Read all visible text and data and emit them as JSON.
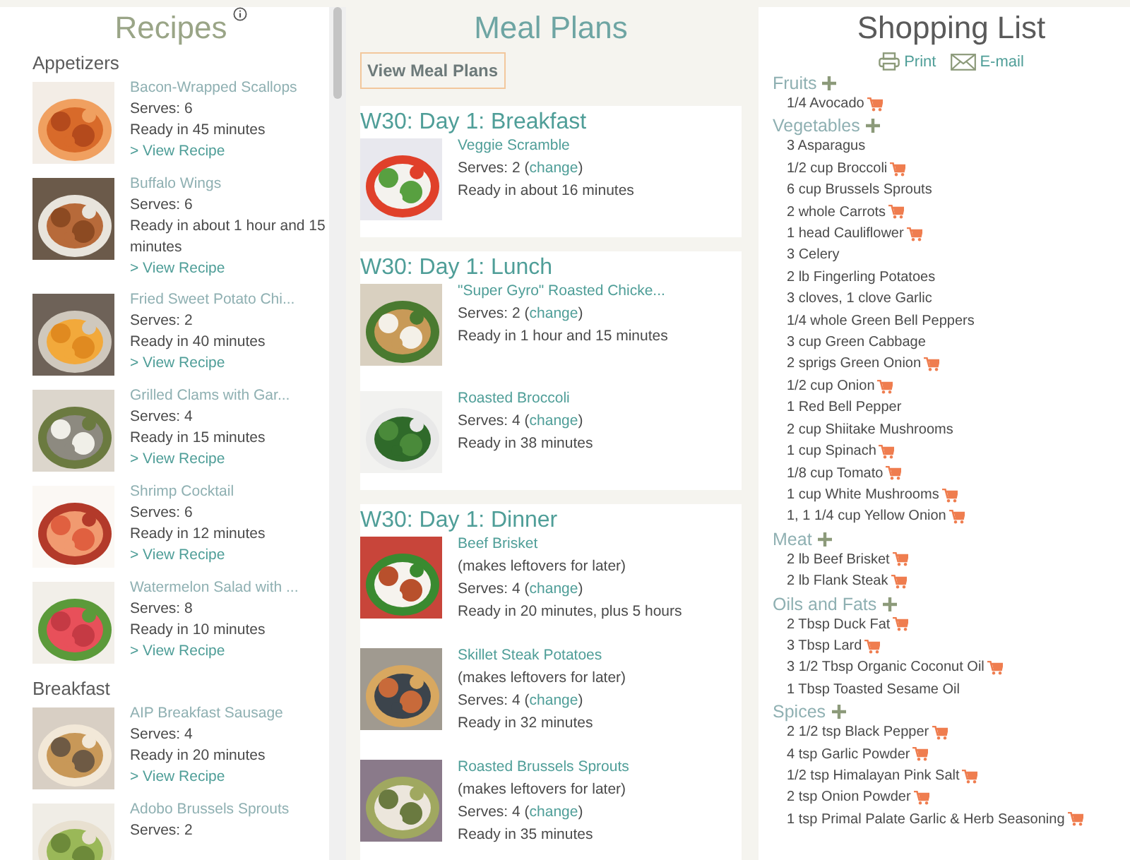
{
  "recipes": {
    "title": "Recipes",
    "sections": [
      {
        "name": "Appetizers",
        "items": [
          {
            "title": "Bacon-Wrapped Scallops",
            "serves": "Serves: 6",
            "ready": "Ready in 45 minutes",
            "link": "> View Recipe",
            "kind": "picture"
          },
          {
            "title": "Buffalo Wings",
            "serves": "Serves: 6",
            "ready": "Ready in about 1 hour and 15 minutes",
            "link": "> View Recipe",
            "kind": "picture"
          },
          {
            "title": "Fried Sweet Potato Chi...",
            "serves": "Serves: 2",
            "ready": "Ready in 40 minutes",
            "link": "> View Recipe",
            "kind": "picture"
          },
          {
            "title": "Grilled Clams with Gar...",
            "serves": "Serves: 4",
            "ready": "Ready in 15 minutes",
            "link": "> View Recipe",
            "kind": "picture"
          },
          {
            "title": "Shrimp Cocktail",
            "serves": "Serves: 6",
            "ready": "Ready in 12 minutes",
            "link": "> View Recipe",
            "kind": "picture"
          },
          {
            "title": "Watermelon Salad with ...",
            "serves": "Serves: 8",
            "ready": "Ready in 10 minutes",
            "link": "> View Recipe",
            "kind": "picture"
          }
        ]
      },
      {
        "name": "Breakfast",
        "items": [
          {
            "title": "AIP Breakfast Sausage",
            "serves": "Serves: 4",
            "ready": "Ready in 20 minutes",
            "link": "> View Recipe",
            "kind": "picture"
          },
          {
            "title": "Adobo Brussels Sprouts",
            "serves": "Serves: 2",
            "kind": "picture"
          }
        ]
      }
    ]
  },
  "meal_plans": {
    "title": "Meal Plans",
    "button": "View Meal Plans",
    "meals": [
      {
        "title": "W30: Day 1: Breakfast",
        "recipes": [
          {
            "name": "Veggie Scramble",
            "serves": "Serves: 2 (",
            "change": "change",
            "close": ")",
            "ready": "Ready in about 16 minutes",
            "kind": "picture"
          }
        ]
      },
      {
        "title": "W30: Day 1: Lunch",
        "recipes": [
          {
            "name": "\"Super Gyro\" Roasted Chicke...",
            "serves": "Serves: 2 (",
            "change": "change",
            "close": ")",
            "ready": "Ready in 1 hour and 15 minutes",
            "kind": "picture"
          },
          {
            "name": "Roasted Broccoli",
            "serves": "Serves: 4 (",
            "change": "change",
            "close": ")",
            "ready": "Ready in 38 minutes",
            "kind": "picture"
          }
        ]
      },
      {
        "title": "W30: Day 1: Dinner",
        "recipes": [
          {
            "name": "Beef Brisket",
            "note": "(makes leftovers for later)",
            "serves": "Serves: 4 (",
            "change": "change",
            "close": ")",
            "ready": "Ready in 20 minutes, plus 5 hours",
            "kind": "picture"
          },
          {
            "name": "Skillet Steak Potatoes",
            "note": "(makes leftovers for later)",
            "serves": "Serves: 4 (",
            "change": "change",
            "close": ")",
            "ready": "Ready in 32 minutes",
            "kind": "picture"
          },
          {
            "name": "Roasted Brussels Sprouts",
            "note": "(makes leftovers for later)",
            "serves": "Serves: 4 (",
            "change": "change",
            "close": ")",
            "ready": "Ready in 35 minutes",
            "kind": "picture"
          }
        ]
      }
    ]
  },
  "shopping_list": {
    "title": "Shopping List",
    "print": "Print",
    "email": "E-mail",
    "categories": [
      {
        "name": "Fruits",
        "items": [
          {
            "text": "1/4 Avocado",
            "cart": true
          }
        ]
      },
      {
        "name": "Vegetables",
        "items": [
          {
            "text": "3 Asparagus",
            "cart": false
          },
          {
            "text": "1/2 cup Broccoli",
            "cart": true
          },
          {
            "text": "6 cup Brussels Sprouts",
            "cart": false
          },
          {
            "text": "2 whole Carrots",
            "cart": true
          },
          {
            "text": "1 head Cauliflower",
            "cart": true
          },
          {
            "text": "3 Celery",
            "cart": false
          },
          {
            "text": "2 lb Fingerling Potatoes",
            "cart": false
          },
          {
            "text": "3 cloves, 1 clove Garlic",
            "cart": false
          },
          {
            "text": "1/4 whole Green Bell Peppers",
            "cart": false
          },
          {
            "text": "3 cup Green Cabbage",
            "cart": false
          },
          {
            "text": "2 sprigs Green Onion",
            "cart": true
          },
          {
            "text": "1/2 cup Onion",
            "cart": true
          },
          {
            "text": "1 Red Bell Pepper",
            "cart": false
          },
          {
            "text": "2 cup Shiitake Mushrooms",
            "cart": false
          },
          {
            "text": "1 cup Spinach",
            "cart": true
          },
          {
            "text": "1/8 cup Tomato",
            "cart": true
          },
          {
            "text": "1 cup White Mushrooms",
            "cart": true
          },
          {
            "text": "1, 1 1/4 cup Yellow Onion",
            "cart": true
          }
        ]
      },
      {
        "name": "Meat",
        "items": [
          {
            "text": "2 lb Beef Brisket",
            "cart": true
          },
          {
            "text": "2 lb Flank Steak",
            "cart": true
          }
        ]
      },
      {
        "name": "Oils and Fats",
        "items": [
          {
            "text": "2 Tbsp Duck Fat",
            "cart": true
          },
          {
            "text": "3 Tbsp Lard",
            "cart": true
          },
          {
            "text": "3 1/2 Tbsp Organic Coconut Oil",
            "cart": true
          },
          {
            "text": "1 Tbsp Toasted Sesame Oil",
            "cart": false
          }
        ]
      },
      {
        "name": "Spices",
        "items": [
          {
            "text": "2 1/2 tsp Black Pepper",
            "cart": true
          },
          {
            "text": "4 tsp Garlic Powder",
            "cart": true
          },
          {
            "text": "1/2 tsp Himalayan Pink Salt",
            "cart": true
          },
          {
            "text": "2 tsp Onion Powder",
            "cart": true
          },
          {
            "text": "1 tsp Primal Palate Garlic & Herb Seasoning",
            "cart": true
          }
        ]
      }
    ]
  }
}
